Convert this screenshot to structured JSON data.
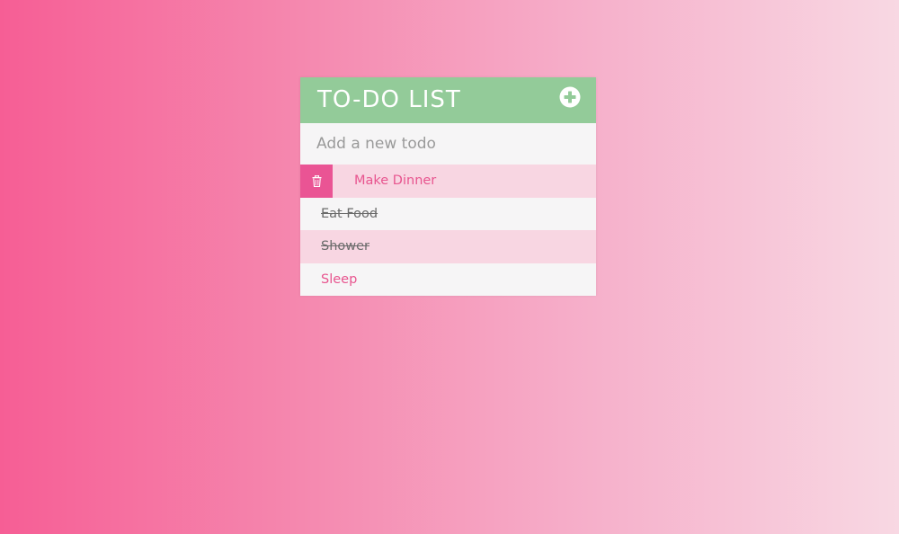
{
  "app": {
    "title": "TO-DO LIST",
    "add_icon": "plus-circle-icon"
  },
  "new_todo": {
    "placeholder": "Add a new todo",
    "value": ""
  },
  "todos": [
    {
      "text": "Make Dinner",
      "completed": false,
      "hovered": true,
      "delete_icon": "trash-icon"
    },
    {
      "text": "Eat Food",
      "completed": true,
      "hovered": false,
      "delete_icon": "trash-icon"
    },
    {
      "text": "Shower",
      "completed": true,
      "hovered": false,
      "delete_icon": "trash-icon"
    },
    {
      "text": "Sleep",
      "completed": false,
      "hovered": false,
      "delete_icon": "trash-icon"
    }
  ],
  "colors": {
    "header": "#93cb99",
    "accent": "#e8558f",
    "delete": "#ea5494",
    "completed_text": "#6b6b6b",
    "odd_row": "#f8d6e2",
    "even_row": "#f6f5f6"
  }
}
